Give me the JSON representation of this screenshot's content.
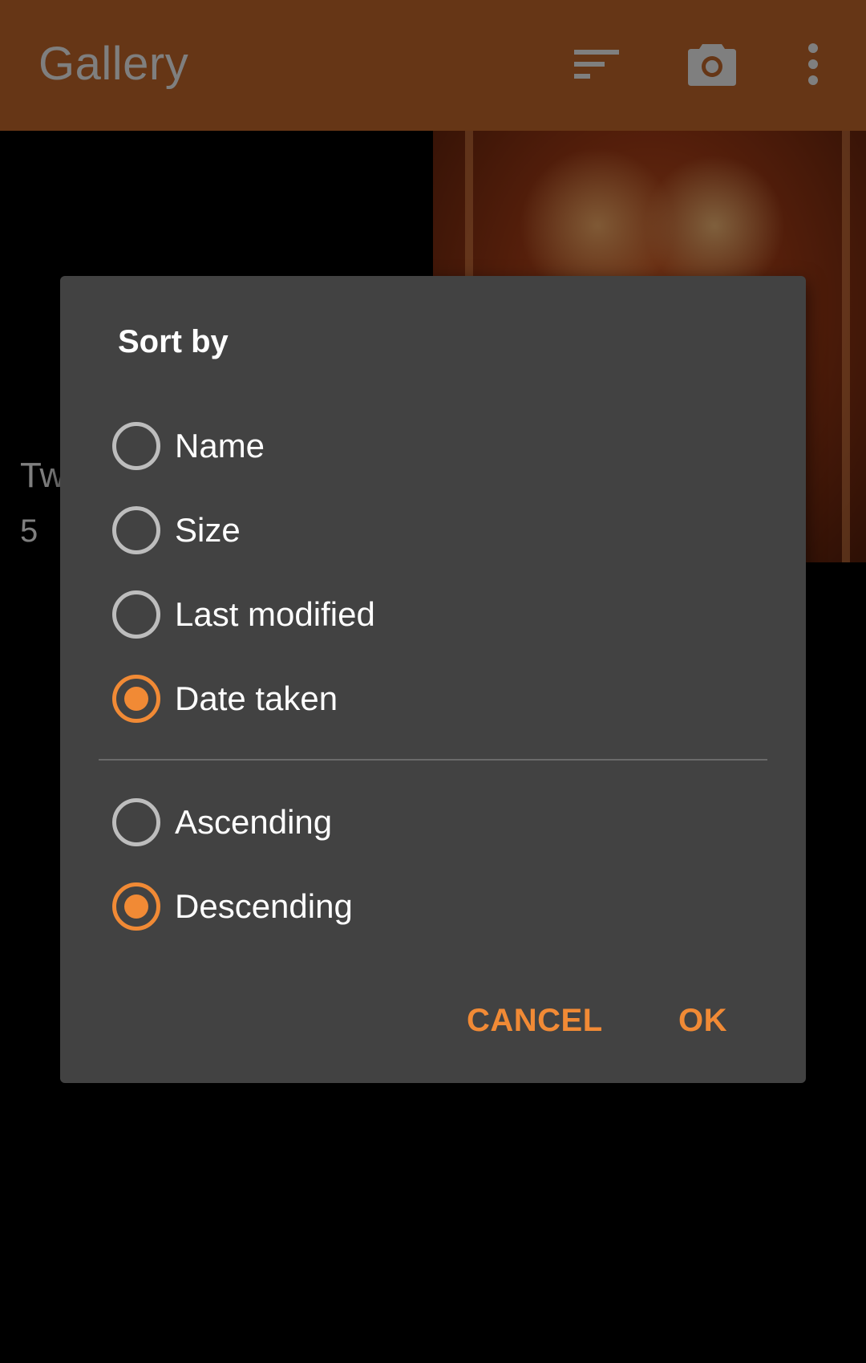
{
  "appbar": {
    "title": "Gallery",
    "icons": [
      "sort-icon",
      "camera-icon",
      "more-vert-icon"
    ],
    "color": "#cc6d2c"
  },
  "album": {
    "name": "Tw",
    "count": "5"
  },
  "dialog": {
    "title": "Sort by",
    "sort_options": [
      {
        "label": "Name",
        "checked": false
      },
      {
        "label": "Size",
        "checked": false
      },
      {
        "label": "Last modified",
        "checked": false
      },
      {
        "label": "Date taken",
        "checked": true
      }
    ],
    "order_options": [
      {
        "label": "Ascending",
        "checked": false
      },
      {
        "label": "Descending",
        "checked": true
      }
    ],
    "cancel_label": "CANCEL",
    "ok_label": "OK",
    "accent_color": "#f18a35"
  }
}
